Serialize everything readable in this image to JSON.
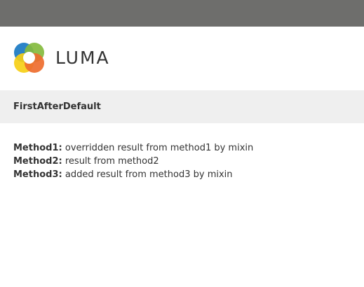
{
  "header": {
    "logo_text": "LUMA",
    "logo_colors": [
      "#1979c3",
      "#82bb3f",
      "#f7d117",
      "#ee6d30"
    ]
  },
  "page": {
    "title": "FirstAfterDefault"
  },
  "methods": [
    {
      "label": "Method1:",
      "value": "overridden result from method1 by mixin"
    },
    {
      "label": "Method2:",
      "value": "result from method2"
    },
    {
      "label": "Method3:",
      "value": "added result from method3 by mixin"
    }
  ]
}
